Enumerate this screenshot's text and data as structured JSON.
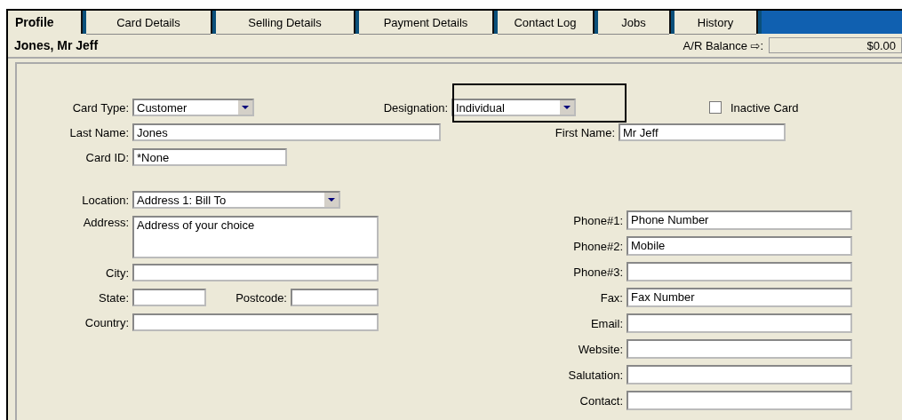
{
  "tabs": [
    {
      "label": "Profile",
      "selected": true
    },
    {
      "label": "Card Details",
      "selected": false
    },
    {
      "label": "Selling Details",
      "selected": false
    },
    {
      "label": "Payment Details",
      "selected": false
    },
    {
      "label": "Contact Log",
      "selected": false
    },
    {
      "label": "Jobs",
      "selected": false
    },
    {
      "label": "History",
      "selected": false
    }
  ],
  "card_name": "Jones, Mr Jeff",
  "balance": {
    "label": "A/R Balance ⇨:",
    "value": "$0.00"
  },
  "card_type": {
    "label": "Card Type:",
    "value": "Customer"
  },
  "designation": {
    "label": "Designation:",
    "value": "Individual",
    "highlighted": true
  },
  "inactive": {
    "label": "Inactive Card",
    "checked": false
  },
  "last_name": {
    "label": "Last Name:",
    "value": "Jones"
  },
  "first_name": {
    "label": "First Name:",
    "value": "Mr Jeff"
  },
  "card_id": {
    "label": "Card ID:",
    "value": "*None"
  },
  "location": {
    "label": "Location:",
    "value": "Address 1:  Bill To"
  },
  "address": {
    "label": "Address:",
    "value": "Address of your choice"
  },
  "city": {
    "label": "City:"
  },
  "state": {
    "label": "State:"
  },
  "postcode": {
    "label": "Postcode:"
  },
  "country": {
    "label": "Country:"
  },
  "contacts": [
    {
      "label": "Phone#1:",
      "value": "Phone Number"
    },
    {
      "label": "Phone#2:",
      "value": "Mobile"
    },
    {
      "label": "Phone#3:"
    },
    {
      "label": "Fax:",
      "value": "Fax Number"
    },
    {
      "label": "Email:"
    },
    {
      "label": "Website:"
    },
    {
      "label": "Salutation:"
    },
    {
      "label": "Contact:"
    }
  ]
}
